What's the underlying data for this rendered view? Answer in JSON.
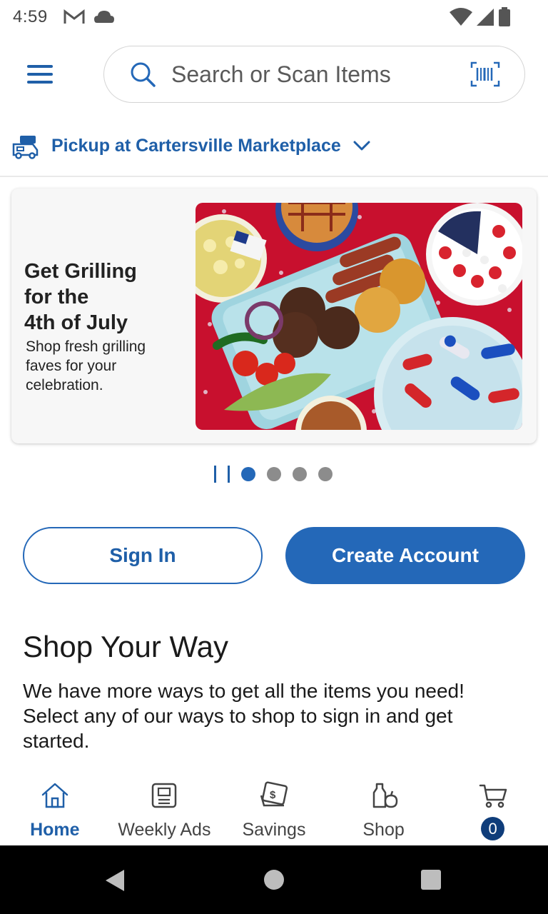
{
  "status_bar": {
    "time": "4:59",
    "left_icons": [
      "gmail-icon",
      "cloud-icon"
    ],
    "right_icons": [
      "wifi-icon",
      "signal-icon",
      "battery-icon"
    ]
  },
  "header": {
    "menu_icon": "hamburger-menu-icon",
    "search": {
      "placeholder": "Search or Scan Items",
      "value": "",
      "scan_icon": "barcode-scan-icon"
    }
  },
  "pickup": {
    "label": "Pickup at Cartersville Marketplace",
    "icon": "pickup-truck-icon"
  },
  "banner": {
    "title": "Get Grilling for the 4th of July",
    "subtitle": "Shop fresh grilling faves for your celebration.",
    "image_subject": "grilled burgers, hot dogs, potato salad, berries and popsicles on red table"
  },
  "carousel": {
    "slide_count": 4,
    "active_index": 0
  },
  "account": {
    "sign_in_label": "Sign In",
    "create_account_label": "Create Account"
  },
  "shop_your_way": {
    "title": "Shop Your Way",
    "description": "We have more ways to get all the items you need! Select any of our ways to shop to sign in and get started."
  },
  "bottom_nav": {
    "items": [
      {
        "label": "Home",
        "icon": "home-icon",
        "active": true
      },
      {
        "label": "Weekly Ads",
        "icon": "newspaper-icon",
        "active": false
      },
      {
        "label": "Savings",
        "icon": "coupon-icon",
        "active": false
      },
      {
        "label": "Shop",
        "icon": "grocery-icon",
        "active": false
      }
    ],
    "cart": {
      "icon": "cart-icon",
      "count": "0"
    }
  },
  "colors": {
    "brand_blue": "#2468b8",
    "link_blue": "#1f5fa8",
    "badge_navy": "#0f3d7a",
    "banner_red": "#c8102e"
  }
}
